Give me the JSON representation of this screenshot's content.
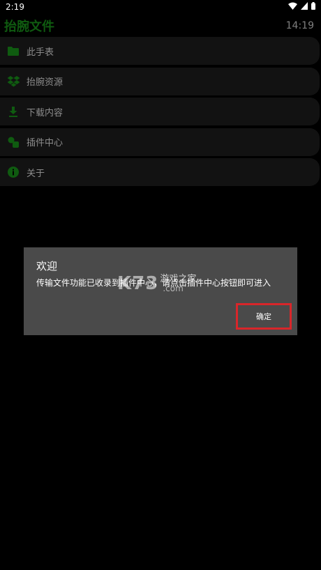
{
  "status_bar": {
    "time": "2:19",
    "icons": [
      "wifi-icon",
      "cellular-signal-icon",
      "battery-icon"
    ]
  },
  "app_bar": {
    "title": "抬腕文件",
    "clock": "14:19"
  },
  "menu": {
    "items": [
      {
        "label": "此手表",
        "icon": "folder-icon"
      },
      {
        "label": "抬腕资源",
        "icon": "dropbox-icon"
      },
      {
        "label": "下载内容",
        "icon": "download-icon"
      },
      {
        "label": "插件中心",
        "icon": "plugin-icon"
      },
      {
        "label": "关于",
        "icon": "info-icon"
      }
    ]
  },
  "dialog": {
    "title": "欢迎",
    "message": "传输文件功能已收录到插件中心，请点击插件中心按钮即可进入",
    "confirm_label": "确定"
  },
  "watermark": {
    "logo": "K73",
    "site": "游戏之家",
    "domain": ".com"
  },
  "colors": {
    "accent_green": "#0f5b10",
    "dialog_bg": "#4a4a4a",
    "highlight_red": "#d9262a"
  }
}
